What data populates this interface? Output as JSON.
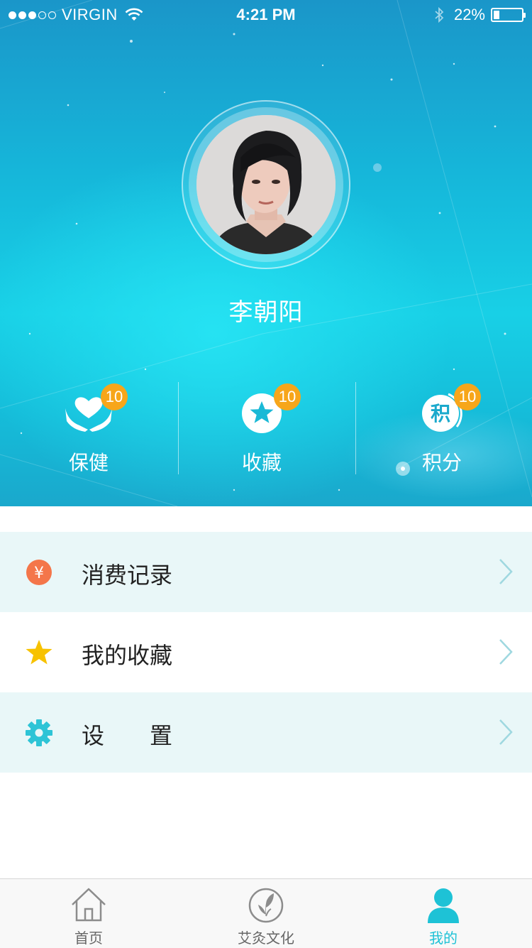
{
  "status_bar": {
    "carrier": "VIRGIN",
    "time": "4:21 PM",
    "battery": "22%",
    "battery_level": 0.22
  },
  "profile": {
    "name": "李朝阳"
  },
  "stats": [
    {
      "label": "保健",
      "badge": "10",
      "icon": "heart-hands-icon"
    },
    {
      "label": "收藏",
      "badge": "10",
      "icon": "star-circle-icon"
    },
    {
      "label": "积分",
      "badge": "10",
      "icon": "points-icon",
      "icon_text": "积"
    }
  ],
  "menu": [
    {
      "label": "消费记录",
      "icon": "yuan-icon",
      "icon_text": "¥"
    },
    {
      "label": "我的收藏",
      "icon": "star-icon"
    },
    {
      "label": "设　　置",
      "icon": "gear-icon"
    }
  ],
  "tabbar": [
    {
      "label": "首页",
      "icon": "home-icon"
    },
    {
      "label": "艾灸文化",
      "icon": "leaf-icon"
    },
    {
      "label": "我的",
      "icon": "person-icon",
      "active": true
    }
  ],
  "colors": {
    "accent": "#1ec2d6",
    "badge": "#f7a61a",
    "yuan": "#f4764a",
    "star": "#f7c200",
    "row_shade": "#e9f7f8"
  }
}
